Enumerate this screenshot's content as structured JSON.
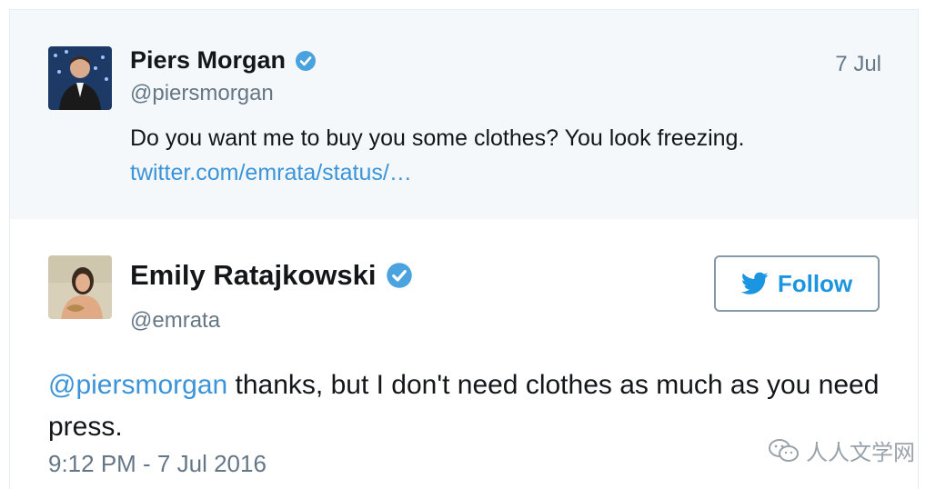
{
  "parent_tweet": {
    "author_name": "Piers Morgan",
    "handle": "@piersmorgan",
    "date": "7 Jul",
    "text": "Do you want me to buy you some clothes? You look freezing.",
    "link": "twitter.com/emrata/status/…",
    "verified_icon": "verified-badge-icon"
  },
  "main_tweet": {
    "author_name": "Emily Ratajkowski",
    "handle": "@emrata",
    "follow_label": "Follow",
    "follow_icon": "twitter-bird-icon",
    "mention": "@piersmorgan",
    "text": " thanks, but I don't need clothes as much as you need press.",
    "timestamp": "9:12 PM - 7 Jul 2016",
    "verified_icon": "verified-badge-icon"
  },
  "watermark": {
    "label": "人人文学网",
    "icon": "wechat-icon"
  },
  "colors": {
    "link": "#3b94d9",
    "follow_accent": "#1b95e0",
    "verified": "#4aa3df",
    "muted_text": "#657786",
    "parent_background": "#f5f8fa"
  }
}
